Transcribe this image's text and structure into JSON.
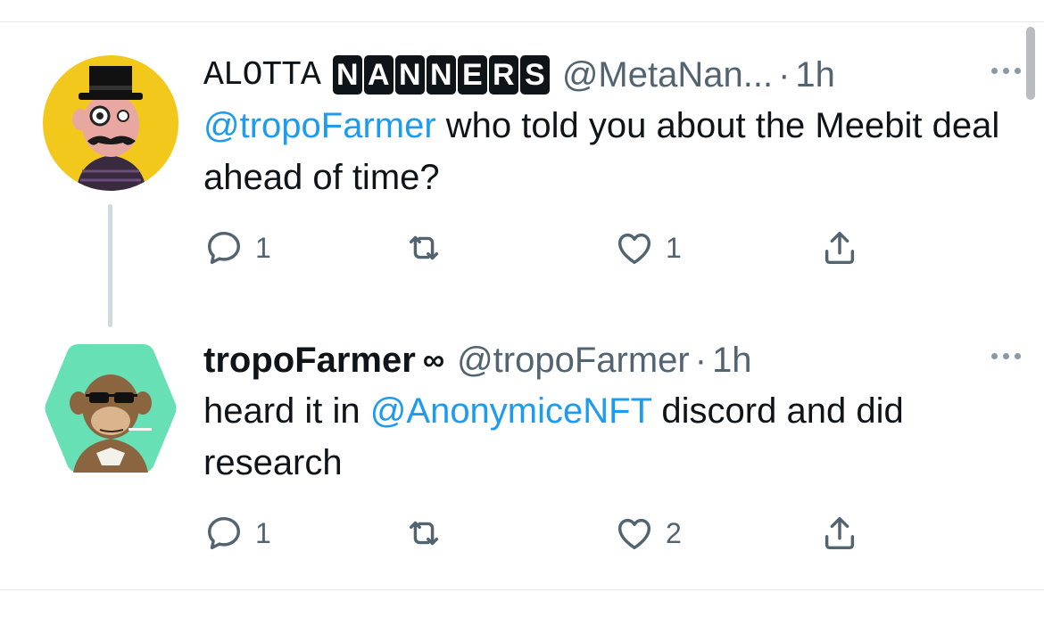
{
  "colors": {
    "link": "#1d9bf0",
    "text": "#0f1419",
    "muted": "#536471",
    "divider": "#e6e9ec",
    "avatar1_bg": "#f2c81c",
    "avatar2_bg": "#67e0b6"
  },
  "tweets": [
    {
      "author": {
        "name_plain": "ALOTTA",
        "name_boxed_letters": [
          "N",
          "A",
          "N",
          "N",
          "E",
          "R",
          "S"
        ],
        "handle": "@MetaNan...",
        "time": "1h"
      },
      "separator": "·",
      "text_parts": [
        {
          "text": "@tropoFarmer",
          "type": "mention"
        },
        {
          "text": " who told you about the Meebit deal ahead of time?",
          "type": "text"
        }
      ],
      "actions": {
        "reply_icon": "reply-icon",
        "reply_count": "1",
        "retweet_icon": "retweet-icon",
        "like_icon": "heart-icon",
        "like_count": "1",
        "share_icon": "share-icon"
      }
    },
    {
      "author": {
        "name": "tropoFarmer",
        "badge": "∞",
        "handle": "@tropoFarmer",
        "time": "1h"
      },
      "separator": "·",
      "text_parts": [
        {
          "text": "heard it in ",
          "type": "text"
        },
        {
          "text": "@AnonymiceNFT",
          "type": "mention"
        },
        {
          "text": " discord and did research",
          "type": "text"
        }
      ],
      "actions": {
        "reply_icon": "reply-icon",
        "reply_count": "1",
        "retweet_icon": "retweet-icon",
        "like_icon": "heart-icon",
        "like_count": "2",
        "share_icon": "share-icon"
      }
    }
  ]
}
